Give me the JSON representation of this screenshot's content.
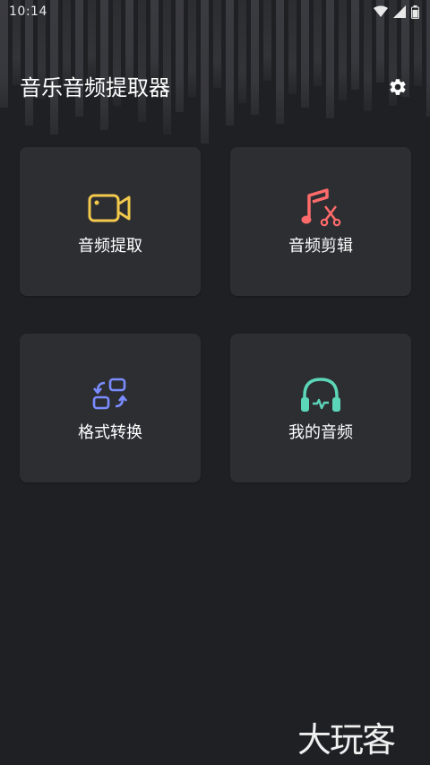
{
  "status_bar": {
    "time": "10:14"
  },
  "header": {
    "title": "音乐音频提取器"
  },
  "cards": [
    {
      "label": "音频提取",
      "icon": "video-camera-icon",
      "color": "#f2c94c"
    },
    {
      "label": "音频剪辑",
      "icon": "music-scissors-icon",
      "color": "#ff6b6b"
    },
    {
      "label": "格式转换",
      "icon": "convert-icon",
      "color": "#7b8cff"
    },
    {
      "label": "我的音频",
      "icon": "headphones-icon",
      "color": "#5cd6b8"
    }
  ],
  "watermark": {
    "text": "大玩客"
  },
  "colors": {
    "background": "#1f2024",
    "card": "#2d2e32"
  }
}
